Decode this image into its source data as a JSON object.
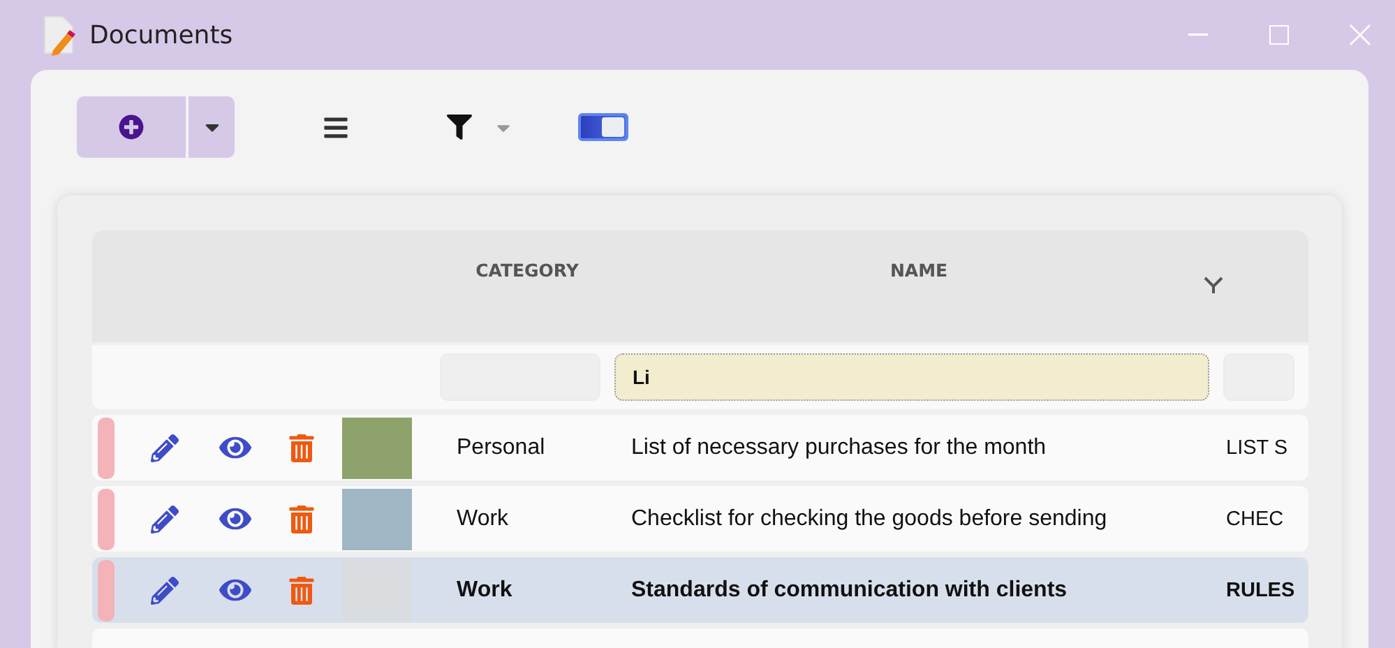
{
  "window": {
    "title": "Documents"
  },
  "toolbar": {
    "view_toggle": {
      "on": true
    }
  },
  "table": {
    "columns": [
      {
        "label": "CATEGORY"
      },
      {
        "label": "NAME",
        "filter": "Li"
      },
      {}
    ],
    "rows": [
      {
        "category": "Personal",
        "name": "List of necessary purchases for the month",
        "column_3": "LIST S",
        "selected": false
      },
      {
        "category": "Work",
        "name": "Checklist for checking the goods before sending",
        "column_3": "CHEC",
        "selected": false
      },
      {
        "category": "Work",
        "name": "Standards of communication with clients",
        "column_3": "RULES",
        "selected": true
      }
    ]
  }
}
